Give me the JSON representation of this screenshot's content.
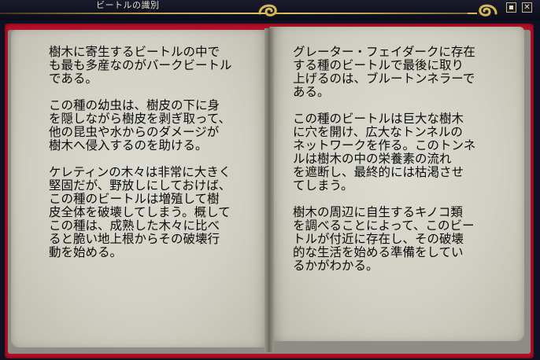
{
  "window": {
    "title": "ビートルの識別",
    "maximize_label": "",
    "close_label": "✕"
  },
  "book": {
    "left_page": {
      "paragraphs": [
        "樹木に寄生するビートルの中で\nも最も多産なのがバークビートル\nである。",
        "この種の幼虫は、樹皮の下に身\nを隠しながら樹皮を剥ぎ取って、\n他の昆虫や水からのダメージが\n樹木へ侵入するのを助ける。",
        "ケレティンの木々は非常に大きく\n堅固だが、野放しにしておけば、\nこの種のビートルは増殖して樹\n皮全体を破壊してしまう。概して\nこの種は、成熟した木々に比べ\nると脆い地上根からその破壊行\n動を始める。"
      ]
    },
    "right_page": {
      "paragraphs": [
        "グレーター・フェイダークに存在\nする種のビートルで最後に取り\n上げるのは、ブルートンネラーで\nある。",
        "この種のビートルは巨大な樹木\nに穴を開け、広大なトンネルの\nネットワークを作る。このトンネ\nルは樹木の中の栄養素の流れ\nを遮断し、最終的には枯渇させ\nてしまう。",
        "樹木の周辺に自生するキノコ類\nを調べることによって、このビー\nトルが付近に存在し、その破壊\n的な生活を始める準備をしてい\nるかがわかる。"
      ]
    }
  },
  "colors": {
    "cover": "#b8112a",
    "page": "#d6d4c8",
    "text": "#080808",
    "frame_gold": "#c8a848"
  }
}
